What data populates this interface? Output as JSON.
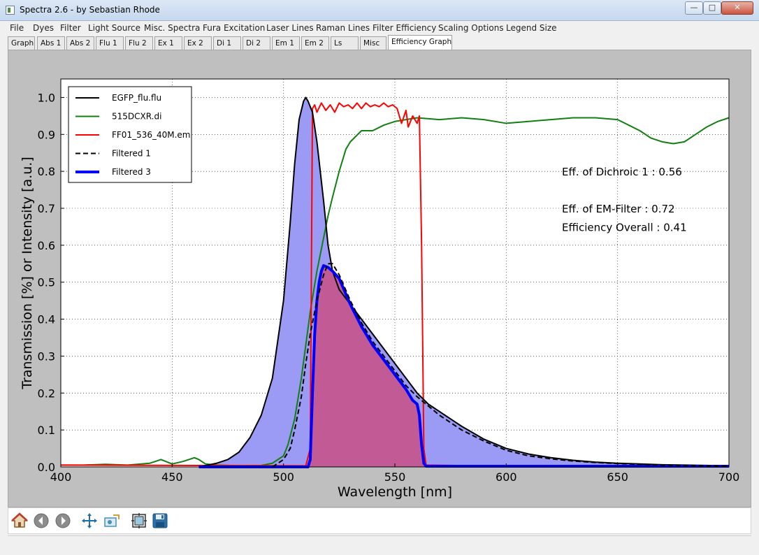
{
  "window": {
    "title": "Spectra 2.6 - by Sebastian Rhode"
  },
  "menu": [
    "File",
    "Dyes",
    "Filter",
    "Light Source",
    "Misc. Spectra",
    "Fura Excitation",
    "Laser Lines",
    "Raman Lines",
    "Filter Efficiency",
    "Scaling Options",
    "Legend Size"
  ],
  "tabs": [
    {
      "label": "Graph",
      "active": false
    },
    {
      "label": "Abs 1",
      "active": false
    },
    {
      "label": "Abs 2",
      "active": false
    },
    {
      "label": "Flu 1",
      "active": false
    },
    {
      "label": "Flu 2",
      "active": false
    },
    {
      "label": "Ex 1",
      "active": false
    },
    {
      "label": "Ex 2",
      "active": false
    },
    {
      "label": "Di 1",
      "active": false
    },
    {
      "label": "Di 2",
      "active": false
    },
    {
      "label": "Em 1",
      "active": false
    },
    {
      "label": "Em 2",
      "active": false
    },
    {
      "label": "Ls",
      "active": false
    },
    {
      "label": "Misc",
      "active": false
    },
    {
      "label": "Efficiency Graph",
      "active": true
    }
  ],
  "toolbar": {
    "icons": [
      "home-icon",
      "back-arrow-icon",
      "forward-arrow-icon",
      "pan-move-icon",
      "zoom-rect-icon",
      "subplot-config-icon",
      "save-disk-icon"
    ]
  },
  "chart_data": {
    "type": "line",
    "title": "",
    "xlabel": "Wavelength [nm]",
    "ylabel": "Transmission [%] or Intensity [a.u.]",
    "xlim": [
      400,
      700
    ],
    "ylim": [
      0.0,
      1.05
    ],
    "xticks": [
      "400",
      "450",
      "500",
      "550",
      "600",
      "650",
      "700"
    ],
    "yticks": [
      "0.0",
      "0.1",
      "0.2",
      "0.3",
      "0.4",
      "0.5",
      "0.6",
      "0.7",
      "0.8",
      "0.9",
      "1.0"
    ],
    "grid": true,
    "legend_position": "top-left",
    "colors": {
      "blue_fill": "#9b9bf5",
      "overlap_fill": "#c25a95",
      "black": "#000000",
      "green": "#118011",
      "red": "#ff0000",
      "blue": "#0000ff"
    },
    "annotations": [
      {
        "text": "Eff. of Dichroic 1 : 0.56",
        "x": 625,
        "y": 0.8
      },
      {
        "text": "Eff. of EM-Filter  : 0.72",
        "x": 625,
        "y": 0.7
      },
      {
        "text": "Efficiency Overall : 0.41",
        "x": 625,
        "y": 0.65
      }
    ],
    "series": [
      {
        "name": "EGFP_flu.flu",
        "color": "#000000",
        "style": "solid",
        "width": 2,
        "fill": "#9b9bf5",
        "x": [
          462,
          470,
          475,
          480,
          485,
          490,
          495,
          500,
          503,
          505,
          507,
          509,
          510,
          511,
          513,
          515,
          518,
          520,
          522,
          525,
          530,
          535,
          540,
          545,
          550,
          555,
          560,
          565,
          570,
          575,
          580,
          590,
          600,
          610,
          620,
          630,
          640,
          650,
          660,
          670,
          680,
          690,
          700
        ],
        "y": [
          0,
          0.01,
          0.02,
          0.04,
          0.08,
          0.14,
          0.24,
          0.45,
          0.66,
          0.82,
          0.94,
          0.99,
          1.0,
          0.99,
          0.96,
          0.88,
          0.72,
          0.6,
          0.53,
          0.48,
          0.44,
          0.4,
          0.36,
          0.32,
          0.28,
          0.24,
          0.2,
          0.17,
          0.15,
          0.13,
          0.11,
          0.075,
          0.05,
          0.035,
          0.025,
          0.018,
          0.013,
          0.01,
          0.008,
          0.006,
          0.005,
          0.004,
          0.003
        ]
      },
      {
        "name": "515DCXR.di",
        "color": "#118011",
        "style": "solid",
        "width": 2,
        "x": [
          400,
          410,
          420,
          430,
          440,
          445,
          450,
          455,
          460,
          462,
          465,
          470,
          480,
          490,
          495,
          500,
          502,
          505,
          508,
          510,
          512,
          515,
          518,
          520,
          522,
          525,
          528,
          530,
          535,
          540,
          545,
          550,
          555,
          560,
          570,
          580,
          590,
          600,
          610,
          620,
          630,
          640,
          650,
          660,
          665,
          670,
          675,
          680,
          685,
          690,
          695,
          700
        ],
        "y": [
          0.005,
          0.005,
          0.007,
          0.005,
          0.01,
          0.02,
          0.008,
          0.015,
          0.025,
          0.02,
          0.008,
          0.005,
          0.003,
          0.004,
          0.01,
          0.03,
          0.06,
          0.13,
          0.24,
          0.33,
          0.42,
          0.53,
          0.62,
          0.68,
          0.73,
          0.8,
          0.86,
          0.88,
          0.91,
          0.91,
          0.925,
          0.935,
          0.94,
          0.945,
          0.94,
          0.945,
          0.94,
          0.93,
          0.935,
          0.94,
          0.945,
          0.945,
          0.94,
          0.91,
          0.89,
          0.88,
          0.875,
          0.88,
          0.9,
          0.92,
          0.935,
          0.945
        ]
      },
      {
        "name": "FF01_536_40M.em",
        "color": "#ff0000",
        "style": "solid",
        "width": 2,
        "x": [
          400,
          510,
          512,
          513,
          514,
          515,
          517,
          519,
          521,
          523,
          525,
          527,
          529,
          531,
          533,
          535,
          537,
          539,
          541,
          543,
          545,
          547,
          549,
          551,
          553,
          555,
          556,
          558,
          560,
          561,
          562,
          563,
          564,
          600,
          650,
          700
        ],
        "y": [
          0.005,
          0.003,
          0.05,
          0.97,
          0.98,
          0.96,
          0.985,
          0.965,
          0.98,
          0.96,
          0.985,
          0.975,
          0.98,
          0.97,
          0.985,
          0.97,
          0.985,
          0.975,
          0.98,
          0.975,
          0.985,
          0.975,
          0.98,
          0.97,
          0.93,
          0.965,
          0.92,
          0.95,
          0.93,
          0.95,
          0.6,
          0.05,
          0.005,
          0.002,
          0.002,
          0.002
        ]
      },
      {
        "name": "Filtered 1",
        "color": "#000000",
        "style": "dashed",
        "width": 2,
        "x": [
          495,
          500,
          503,
          505,
          508,
          510,
          512,
          515,
          518,
          520,
          522,
          525,
          530,
          535,
          540,
          545,
          550,
          555,
          560,
          570,
          580,
          590,
          600,
          610,
          620,
          630,
          640,
          650,
          660,
          670,
          680,
          690,
          700
        ],
        "y": [
          0,
          0.02,
          0.05,
          0.1,
          0.19,
          0.28,
          0.36,
          0.45,
          0.52,
          0.55,
          0.55,
          0.52,
          0.45,
          0.39,
          0.34,
          0.3,
          0.26,
          0.22,
          0.19,
          0.14,
          0.1,
          0.07,
          0.045,
          0.03,
          0.022,
          0.016,
          0.012,
          0.009,
          0.007,
          0.005,
          0.004,
          0.003,
          0.002
        ]
      },
      {
        "name": "Filtered 3",
        "color": "#0000ff",
        "style": "solid",
        "width": 4,
        "fill": "#c25a95",
        "x": [
          462,
          511,
          512,
          513,
          514,
          515,
          516,
          517,
          518,
          520,
          522,
          525,
          530,
          535,
          540,
          545,
          550,
          555,
          558,
          560,
          561,
          562,
          563,
          564,
          600,
          650,
          700
        ],
        "y": [
          0,
          0,
          0.02,
          0.2,
          0.36,
          0.45,
          0.5,
          0.53,
          0.545,
          0.54,
          0.53,
          0.51,
          0.44,
          0.38,
          0.33,
          0.29,
          0.25,
          0.21,
          0.18,
          0.17,
          0.14,
          0.06,
          0.01,
          0.002,
          0.002,
          0.002,
          0.002
        ]
      }
    ]
  }
}
